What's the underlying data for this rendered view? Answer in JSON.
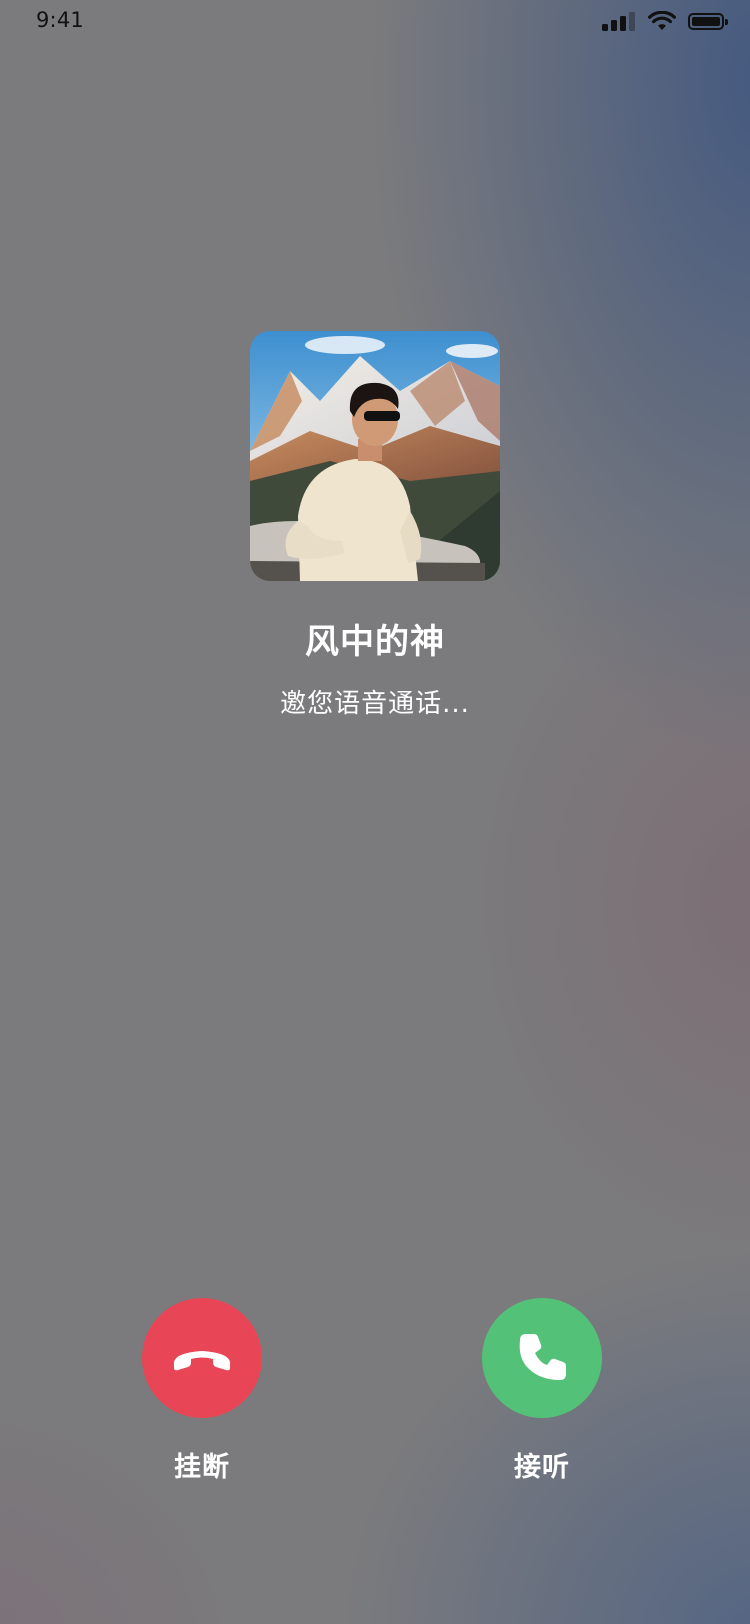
{
  "status_bar": {
    "time": "9:41",
    "icons": [
      "cellular-signal-icon",
      "wifi-icon",
      "battery-icon"
    ]
  },
  "caller": {
    "name": "风中的神",
    "status": "邀您语音通话..."
  },
  "actions": {
    "decline": {
      "label": "挂断",
      "icon": "phone-hangup-icon",
      "color": "#E84656"
    },
    "accept": {
      "label": "接听",
      "icon": "phone-icon",
      "color": "#53C278"
    }
  }
}
